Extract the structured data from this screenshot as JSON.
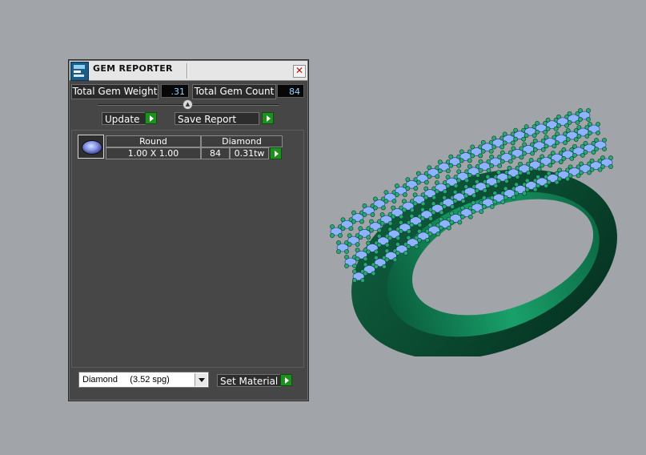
{
  "window": {
    "title": "GEM REPORTER",
    "close_glyph": "✕"
  },
  "summary": {
    "weight_label": "Total Gem Weight",
    "weight_value": ".31",
    "count_label": "Total Gem Count",
    "count_value": "84"
  },
  "toolbar": {
    "update_label": "Update",
    "save_report_label": "Save Report"
  },
  "gem_list": [
    {
      "icon": "round-gem-icon",
      "shape": "Round",
      "material": "Diamond",
      "size": "1.00 X 1.00",
      "count": "84",
      "weight": "0.31tw"
    }
  ],
  "material": {
    "selected": "Diamond     (3.52 spg)",
    "set_label": "Set Material"
  },
  "colors": {
    "ring_metal": "#0e7a55",
    "prong_green": "#2aa874",
    "gem_blue": "#8fb4ff",
    "go_button": "#1f8f1f",
    "panel_bg": "#464646"
  }
}
